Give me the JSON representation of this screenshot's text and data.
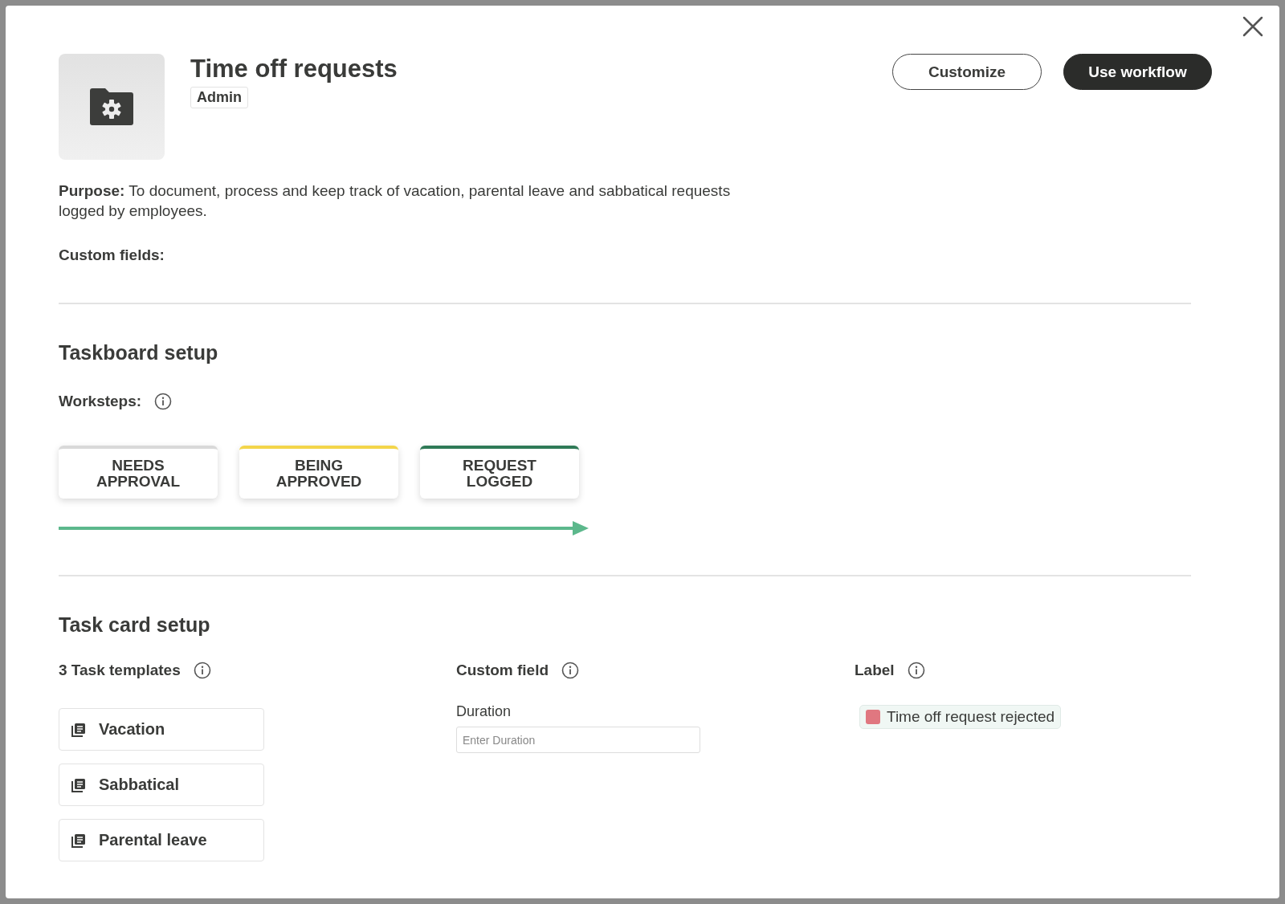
{
  "header": {
    "title": "Time off requests",
    "badge": "Admin",
    "buttons": [
      {
        "label": "Customize",
        "kind": "secondary"
      },
      {
        "label": "Use workflow",
        "kind": "primary"
      }
    ]
  },
  "purpose": {
    "text": "**Purpose:** To document, process and keep track of vacation, parental leave and sabbatical requests logged by employees."
  },
  "custom_fields_heading": "Custom fields:",
  "taskboard": {
    "title": "Taskboard setup",
    "worksteps_label": "Worksteps:",
    "worksteps": [
      {
        "label": "NEEDS APPROVAL",
        "color": "#d9d9d9"
      },
      {
        "label": "BEING APPROVED",
        "color": "#f3d54a"
      },
      {
        "label": "REQUEST LOGGED",
        "color": "#2f7a57"
      }
    ]
  },
  "task_card": {
    "title": "Task card setup",
    "templates": {
      "heading": "3 Task templates",
      "items": [
        "Vacation",
        "Sabbatical",
        "Parental leave"
      ]
    },
    "custom_field": {
      "heading": "Custom field",
      "field_label": "Duration",
      "placeholder": "Enter Duration"
    },
    "label": {
      "heading": "Label",
      "tags": [
        {
          "text": "Time off request rejected",
          "color": "#e07780"
        }
      ]
    }
  }
}
